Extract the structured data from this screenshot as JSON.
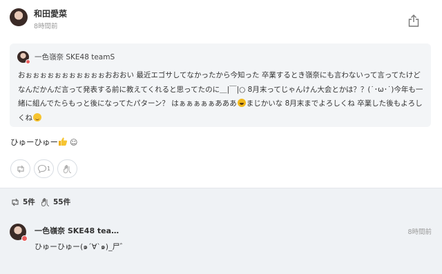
{
  "post": {
    "author": "和田愛菜",
    "time": "8時間前",
    "body": "ひゅーひゅー",
    "body_suffix": "☺"
  },
  "quote": {
    "author": "一色嶺奈 SKE48 teamS",
    "text_part1": "おぉぉぉぉぉぉぉぉぉぉぉおおおい 最近エゴサしてなかったから今知った 卒業するとき嶺奈にも言わないって言ってたけどなんだかんだ言って発表する前に教えてくれると思ってたのに＿|￣|○ 8月末ってじゃんけん大会とかは？？(˙･ω･˙)今年も一緒に組んでたらもっと後になってたパターン？ はぁぁぁぁぁあああ",
    "text_part2": "まじかいな 8月末までよろしくね 卒業した後もよろしくね",
    "emoji_1": "tired-face-emoji",
    "emoji_2": "smiling-face-emoji"
  },
  "actions": {
    "retweet_label": "",
    "comment_count": "1",
    "clap_label": ""
  },
  "stats": {
    "retweets": "5件",
    "claps": "55件"
  },
  "comment": {
    "author": "一色嶺奈 SKE48 tea…",
    "time": "8時間前",
    "text": "ひゅーひゅー(๑´∀`๑)_尸゛"
  },
  "icons": {
    "share": "share-icon",
    "retweet": "retweet-icon",
    "comment": "comment-icon",
    "clap": "clap-icon",
    "thumbs_up": "thumbs-up-icon"
  },
  "colors": {
    "background": "#ffffff",
    "quote_bg": "#f3f5f7",
    "stats_bg": "#eff2f5",
    "verified": "#e85d5d",
    "muted": "#999999"
  }
}
